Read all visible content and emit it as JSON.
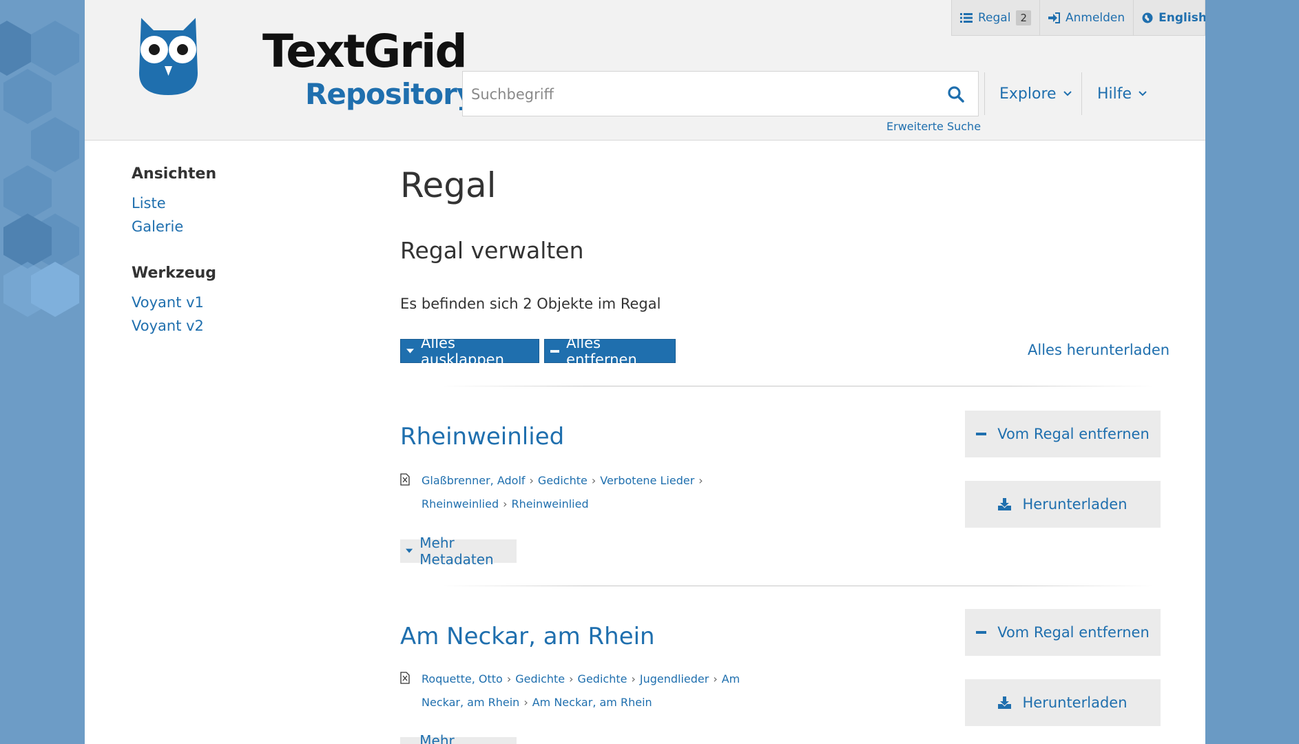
{
  "logo": {
    "word": "TextGrid",
    "sub": "Repository"
  },
  "topbar": {
    "shelf_label": "Regal",
    "shelf_count": "2",
    "login_label": "Anmelden",
    "language_label": "English"
  },
  "search": {
    "placeholder": "Suchbegriff",
    "advanced_label": "Erweiterte Suche"
  },
  "nav": {
    "explore_label": "Explore",
    "help_label": "Hilfe"
  },
  "sidebar": {
    "views_heading": "Ansichten",
    "views": [
      {
        "label": "Liste"
      },
      {
        "label": "Galerie"
      }
    ],
    "tools_heading": "Werkzeug",
    "tools": [
      {
        "label": "Voyant v1"
      },
      {
        "label": "Voyant v2"
      }
    ]
  },
  "main": {
    "title": "Regal",
    "subtitle": "Regal verwalten",
    "count_text": "Es befinden sich 2 Objekte im Regal",
    "expand_all_label": "Alles ausklappen",
    "remove_all_label": "Alles entfernen",
    "download_all_label": "Alles herunterladen",
    "items": [
      {
        "title": "Rheinweinlied",
        "breadcrumb": [
          "Glaßbrenner, Adolf",
          "Gedichte",
          "Verbotene Lieder",
          "Rheinweinlied",
          "Rheinweinlied"
        ],
        "more_label": "Mehr Metadaten",
        "remove_label": "Vom Regal entfernen",
        "download_label": "Herunterladen"
      },
      {
        "title": "Am Neckar, am Rhein",
        "breadcrumb": [
          "Roquette, Otto",
          "Gedichte",
          "Gedichte",
          "Jugendlieder",
          "Am Neckar, am Rhein",
          "Am Neckar, am Rhein"
        ],
        "more_label": "Mehr Metadaten",
        "remove_label": "Vom Regal entfernen",
        "download_label": "Herunterladen"
      }
    ]
  },
  "colors": {
    "brand": "#1f6fae",
    "header_bg": "#f2f2f2",
    "button_gray": "#ebebeb"
  }
}
